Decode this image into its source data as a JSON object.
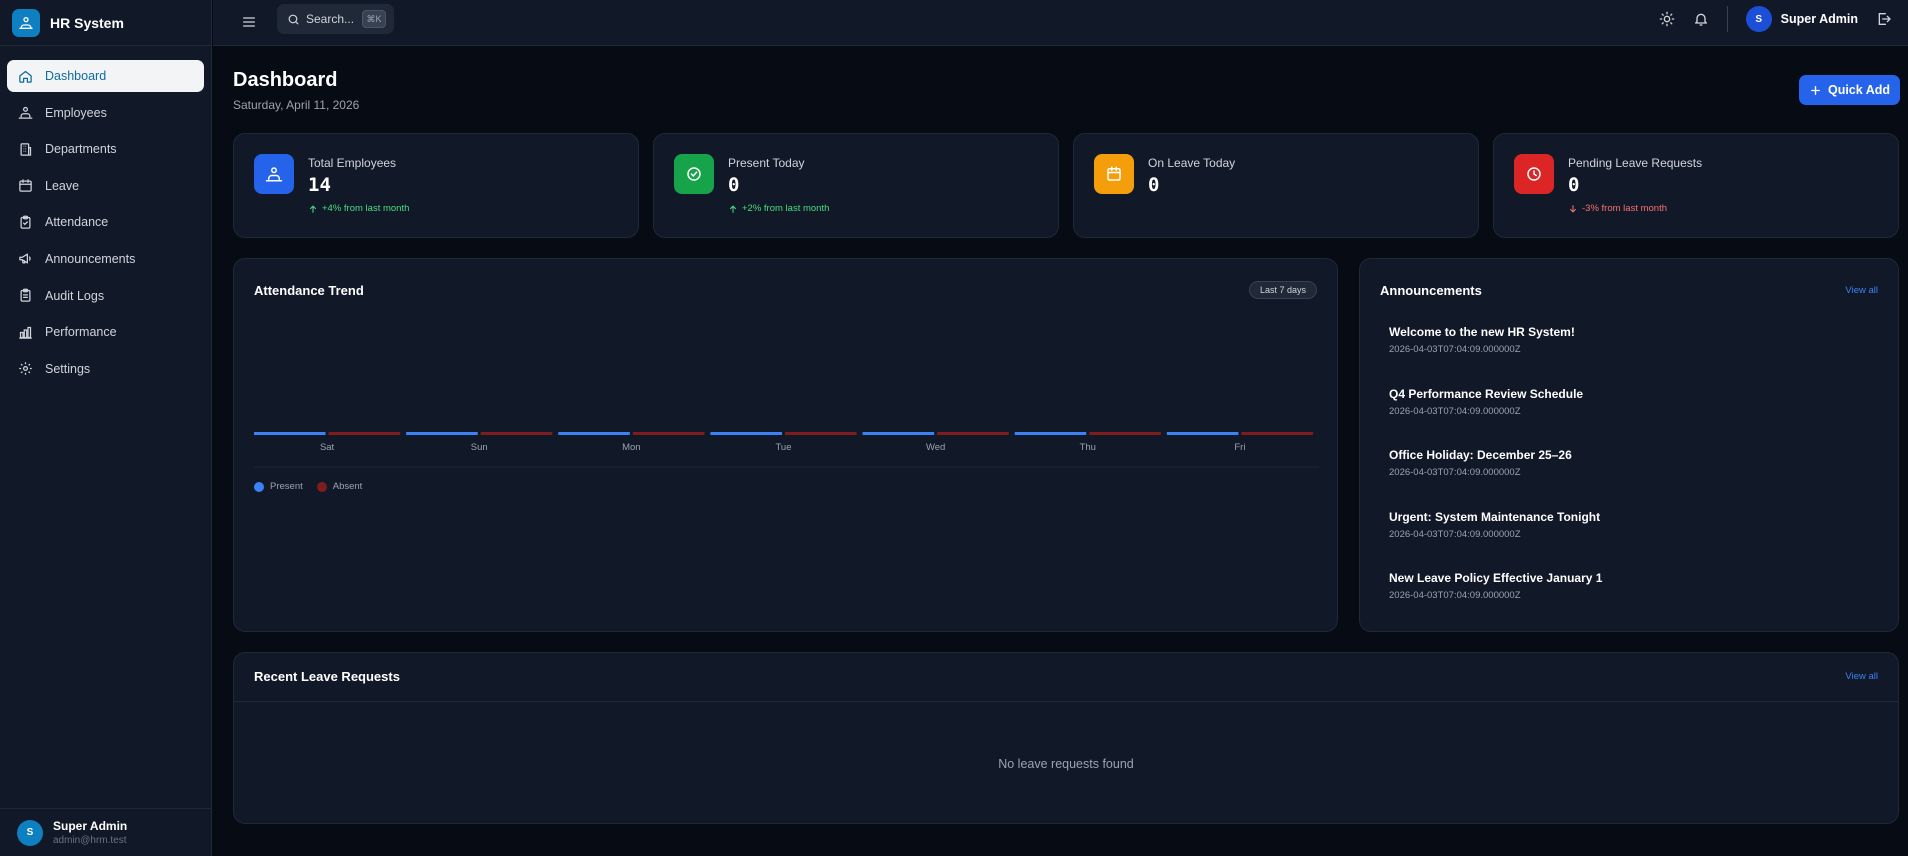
{
  "app": {
    "name": "HR System"
  },
  "sidebar": {
    "items": [
      {
        "label": "Dashboard",
        "icon": "home-icon",
        "active": true
      },
      {
        "label": "Employees",
        "icon": "users-icon"
      },
      {
        "label": "Departments",
        "icon": "building-icon"
      },
      {
        "label": "Leave",
        "icon": "calendar-icon"
      },
      {
        "label": "Attendance",
        "icon": "clipboard-check-icon"
      },
      {
        "label": "Announcements",
        "icon": "megaphone-icon"
      },
      {
        "label": "Audit Logs",
        "icon": "clipboard-list-icon"
      },
      {
        "label": "Performance",
        "icon": "bar-chart-icon"
      },
      {
        "label": "Settings",
        "icon": "gear-icon"
      }
    ],
    "user": {
      "initial": "S",
      "name": "Super Admin",
      "email": "admin@hrm.test"
    }
  },
  "topbar": {
    "search_label": "Search...",
    "search_shortcut": "⌘K",
    "user": {
      "initial": "S",
      "name": "Super Admin"
    }
  },
  "page": {
    "title": "Dashboard",
    "date": "Saturday, April 11, 2026",
    "quick_add": "Quick Add"
  },
  "stats": [
    {
      "label": "Total Employees",
      "value": "14",
      "trend": "+4% from last month",
      "trend_dir": "up",
      "color": "#2563eb",
      "icon": "users-icon"
    },
    {
      "label": "Present Today",
      "value": "0",
      "trend": "+2% from last month",
      "trend_dir": "up",
      "color": "#16a34a",
      "icon": "check-circle-icon"
    },
    {
      "label": "On Leave Today",
      "value": "0",
      "trend": "",
      "trend_dir": "",
      "color": "#f59e0b",
      "icon": "calendar-icon"
    },
    {
      "label": "Pending Leave Requests",
      "value": "0",
      "trend": "-3% from last month",
      "trend_dir": "down",
      "color": "#dc2626",
      "icon": "clock-icon"
    }
  ],
  "attendance": {
    "title": "Attendance Trend",
    "range": "Last 7 days",
    "legend": {
      "present": "Present",
      "absent": "Absent"
    }
  },
  "chart_data": {
    "type": "bar",
    "categories": [
      "Sat",
      "Sun",
      "Mon",
      "Tue",
      "Wed",
      "Thu",
      "Fri"
    ],
    "series": [
      {
        "name": "Present",
        "values": [
          0,
          0,
          0,
          0,
          0,
          0,
          0
        ],
        "color": "#3b82f6"
      },
      {
        "name": "Absent",
        "values": [
          0,
          0,
          0,
          0,
          0,
          0,
          0
        ],
        "color": "#7f1d1d"
      }
    ],
    "grid": false,
    "legend": "bottom-left"
  },
  "announcements": {
    "title": "Announcements",
    "view_all": "View all",
    "items": [
      {
        "title": "Welcome to the new HR System!",
        "date": "2026-04-03T07:04:09.000000Z"
      },
      {
        "title": "Q4 Performance Review Schedule",
        "date": "2026-04-03T07:04:09.000000Z"
      },
      {
        "title": "Office Holiday: December 25–26",
        "date": "2026-04-03T07:04:09.000000Z"
      },
      {
        "title": "Urgent: System Maintenance Tonight",
        "date": "2026-04-03T07:04:09.000000Z"
      },
      {
        "title": "New Leave Policy Effective January 1",
        "date": "2026-04-03T07:04:09.000000Z"
      }
    ]
  },
  "leave_requests": {
    "title": "Recent Leave Requests",
    "view_all": "View all",
    "empty": "No leave requests found"
  }
}
